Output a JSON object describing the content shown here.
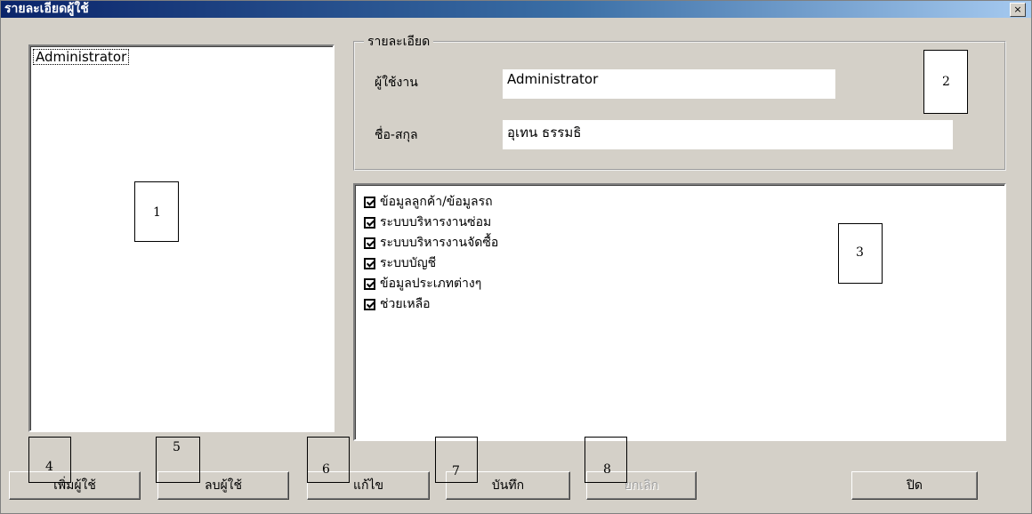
{
  "window": {
    "title": "รายละเอียดผู้ใช้",
    "close_glyph": "×"
  },
  "user_list": {
    "items": [
      "Administrator"
    ]
  },
  "details": {
    "group_label": "รายละเอียด",
    "username_label": "ผู้ใช้งาน",
    "username_value": "Administrator",
    "fullname_label": "ชื่อ-สกุล",
    "fullname_value": "อุเทน ธรรมธิ"
  },
  "permissions": [
    {
      "label": "ข้อมูลลูกค้า/ข้อมูลรถ",
      "checked": true
    },
    {
      "label": "ระบบบริหารงานซ่อม",
      "checked": true
    },
    {
      "label": "ระบบบริหารงานจัดซื้อ",
      "checked": true
    },
    {
      "label": "ระบบบัญชี",
      "checked": true
    },
    {
      "label": "ข้อมูลประเภทต่างๆ",
      "checked": true
    },
    {
      "label": "ช่วยเหลือ",
      "checked": true
    }
  ],
  "buttons": {
    "add_user": "เพิ่มผู้ใช้",
    "delete_user": "ลบผู้ใช้",
    "edit": "แก้ไข",
    "save": "บันทึก",
    "cancel": "ยกเลิก",
    "close": "ปิด"
  },
  "callouts": [
    "1",
    "2",
    "3",
    "4",
    "5",
    "6",
    "7",
    "8"
  ]
}
